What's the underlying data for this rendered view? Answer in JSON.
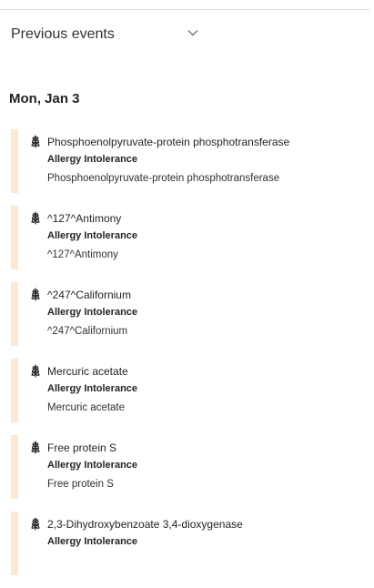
{
  "previous_events": {
    "label": "Previous events",
    "icon": "chevron-down-icon"
  },
  "date_heading": "Mon, Jan 3",
  "colors": {
    "event_accent": "#fce8d4",
    "divider": "#e1dfdd",
    "text": "#252423"
  },
  "events": [
    {
      "icon": "wheat-allergy-icon",
      "title": "Phosphoenolpyruvate-protein phosphotransferase",
      "category": "Allergy Intolerance",
      "detail": "Phosphoenolpyruvate-protein phosphotransferase"
    },
    {
      "icon": "wheat-allergy-icon",
      "title": "^127^Antimony",
      "category": "Allergy Intolerance",
      "detail": "^127^Antimony"
    },
    {
      "icon": "wheat-allergy-icon",
      "title": "^247^Californium",
      "category": "Allergy Intolerance",
      "detail": "^247^Californium"
    },
    {
      "icon": "wheat-allergy-icon",
      "title": "Mercuric acetate",
      "category": "Allergy Intolerance",
      "detail": "Mercuric acetate"
    },
    {
      "icon": "wheat-allergy-icon",
      "title": "Free protein S",
      "category": "Allergy Intolerance",
      "detail": "Free protein S"
    },
    {
      "icon": "wheat-allergy-icon",
      "title": "2,3-Dihydroxybenzoate 3,4-dioxygenase",
      "category": "Allergy Intolerance",
      "detail": ""
    }
  ]
}
